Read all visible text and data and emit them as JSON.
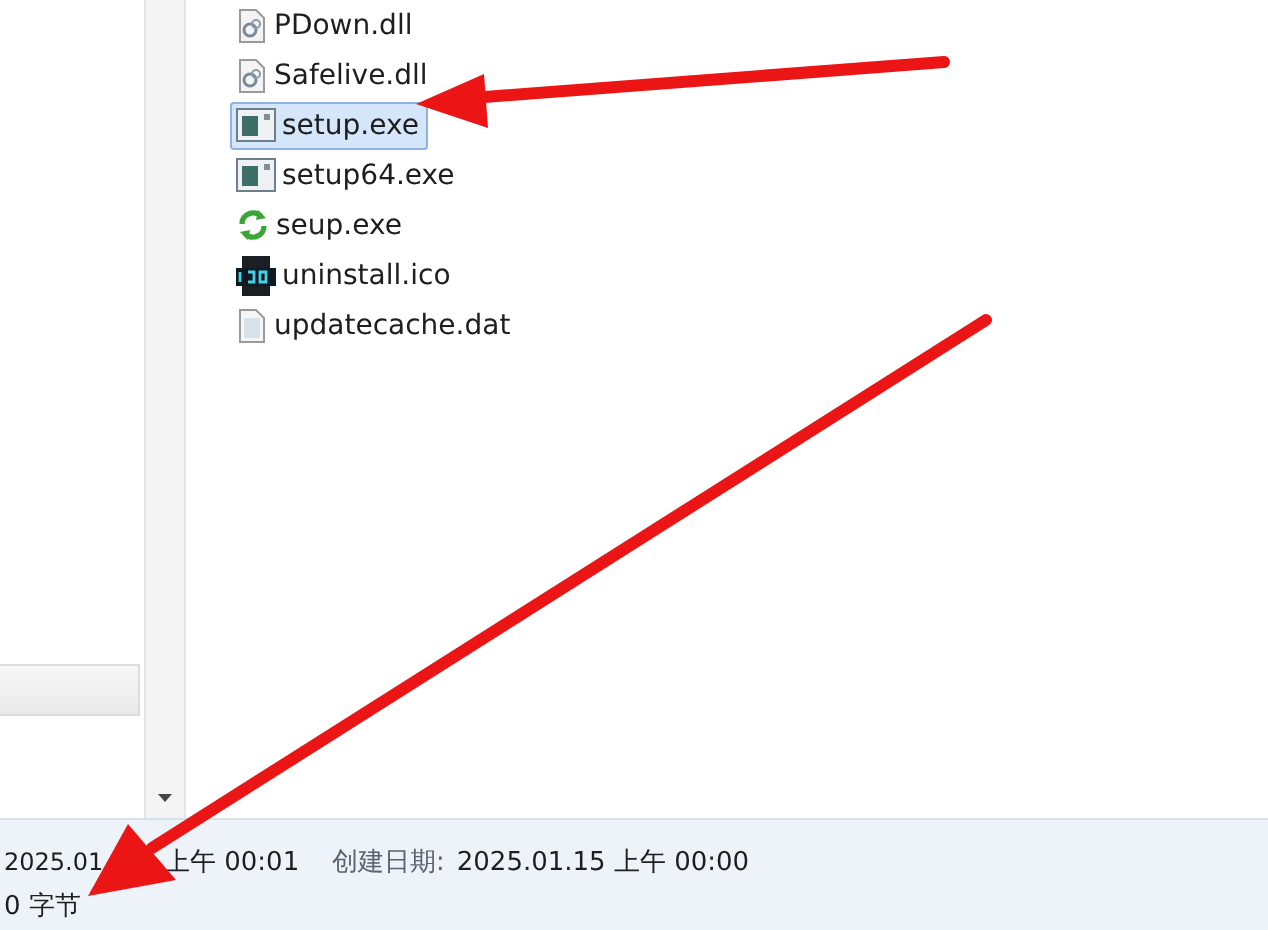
{
  "files": [
    {
      "name": "PDown.dll",
      "kind": "dll",
      "selected": false
    },
    {
      "name": "Safelive.dll",
      "kind": "dll",
      "selected": false
    },
    {
      "name": "setup.exe",
      "kind": "exe",
      "selected": true
    },
    {
      "name": "setup64.exe",
      "kind": "exe",
      "selected": false
    },
    {
      "name": "seup.exe",
      "kind": "refresh",
      "selected": false
    },
    {
      "name": "uninstall.ico",
      "kind": "ico",
      "selected": false
    },
    {
      "name": "updatecache.dat",
      "kind": "doc",
      "selected": false
    }
  ],
  "details": {
    "modified_parts": [
      "2025.01",
      "上午 00:01"
    ],
    "created_label": "创建日期:",
    "created_value": "2025.01.15 上午 00:00",
    "size": "0 字节"
  }
}
